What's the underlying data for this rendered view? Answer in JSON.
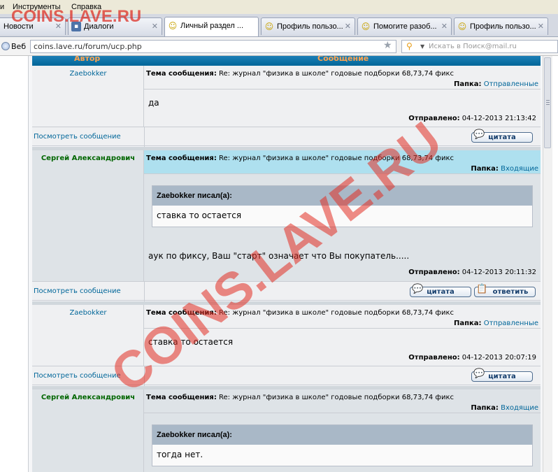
{
  "menu": {
    "items": [
      "и",
      "Инструменты",
      "Справка"
    ]
  },
  "tabs": [
    {
      "label": "Новости",
      "icon": "page-icon"
    },
    {
      "label": "Диалоги",
      "icon": "chat-icon"
    },
    {
      "label": "Личный раздел ...",
      "icon": "smiley-icon"
    },
    {
      "label": "Профиль пользо...",
      "icon": "smiley-icon"
    },
    {
      "label": "Помогите разоб...",
      "icon": "smiley-icon"
    },
    {
      "label": "Профиль пользо...",
      "icon": "smiley-icon"
    }
  ],
  "address": {
    "web_label": "Веб",
    "url": "coins.lave.ru/forum/ucp.php",
    "search_placeholder": "Искать в Поиск@mail.ru"
  },
  "table": {
    "header_author": "Автор",
    "header_message": "Сообщение"
  },
  "labels": {
    "subject": "Тема сообщения:",
    "folder": "Папка:",
    "sent": "Отправлено:",
    "view_message": "Посмотреть сообщение",
    "quote_btn": "цитата",
    "reply_btn": "ответить",
    "wrote_suffix": "писал(а):"
  },
  "posts": [
    {
      "author": "Zaebokker",
      "subject": "Re: журнал \"физика в школе\" годовые подборки 68,73,74 фикс",
      "folder": "Отправленные",
      "body": "да",
      "sent": "04-12-2013 21:13:42"
    },
    {
      "author": "Сергей Александрович",
      "subject": "Re: журнал \"физика в школе\" годовые подборки 68,73,74 фикс",
      "folder": "Входящие",
      "quote_author": "Zaebokker писал(а):",
      "quote_text": "ставка то остается",
      "body": "аук по фиксу, Ваш \"старт\" означает что Вы покупатель.....",
      "sent": "04-12-2013 20:11:32"
    },
    {
      "author": "Zaebokker",
      "subject": "Re: журнал \"физика в школе\" годовые подборки 68,73,74 фикс",
      "folder": "Отправленные",
      "body": "ставка то остается",
      "sent": "04-12-2013 20:07:19"
    },
    {
      "author": "Сергей Александрович",
      "subject": "Re: журнал \"физика в школе\" годовые подборки 68,73,74 фикс",
      "folder": "Входящие",
      "quote_author": "Zaebokker писал(а):",
      "quote_text": "тогда нет."
    }
  ],
  "watermark": {
    "text": "COINS.LAVE.RU"
  },
  "colors": {
    "watermark": "#dc281e",
    "link": "#006699",
    "author_green": "#006600",
    "header_bar": "#006699"
  }
}
